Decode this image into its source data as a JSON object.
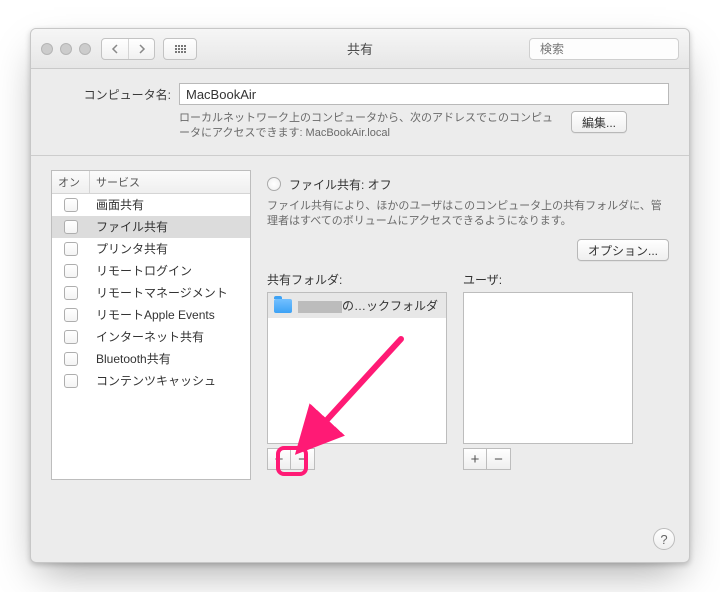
{
  "window": {
    "title": "共有"
  },
  "toolbar": {
    "search_placeholder": "検索"
  },
  "computer_name": {
    "label": "コンピュータ名:",
    "value": "MacBookAir",
    "note": "ローカルネットワーク上のコンピュータから、次のアドレスでこのコンピュータにアクセスできます: MacBookAir.local",
    "edit_button": "編集..."
  },
  "service_table": {
    "on_header": "オン",
    "service_header": "サービス",
    "rows": [
      {
        "label": "画面共有",
        "on": false,
        "selected": false
      },
      {
        "label": "ファイル共有",
        "on": false,
        "selected": true
      },
      {
        "label": "プリンタ共有",
        "on": false,
        "selected": false
      },
      {
        "label": "リモートログイン",
        "on": false,
        "selected": false
      },
      {
        "label": "リモートマネージメント",
        "on": false,
        "selected": false
      },
      {
        "label": "リモートApple Events",
        "on": false,
        "selected": false
      },
      {
        "label": "インターネット共有",
        "on": false,
        "selected": false
      },
      {
        "label": "Bluetooth共有",
        "on": false,
        "selected": false
      },
      {
        "label": "コンテンツキャッシュ",
        "on": false,
        "selected": false
      }
    ]
  },
  "detail": {
    "status_label": "ファイル共有: オフ",
    "description": "ファイル共有により、ほかのユーザはこのコンピュータ上の共有フォルダに、管理者はすべてのボリュームにアクセスできるようになります。",
    "options_button": "オプション...",
    "folders_label": "共有フォルダ:",
    "users_label": "ユーザ:",
    "folder_item_suffix": "の…ックフォルダ",
    "add_label": "+",
    "remove_label": "−",
    "help_label": "?"
  },
  "colors": {
    "annotation": "#ff1a75"
  }
}
